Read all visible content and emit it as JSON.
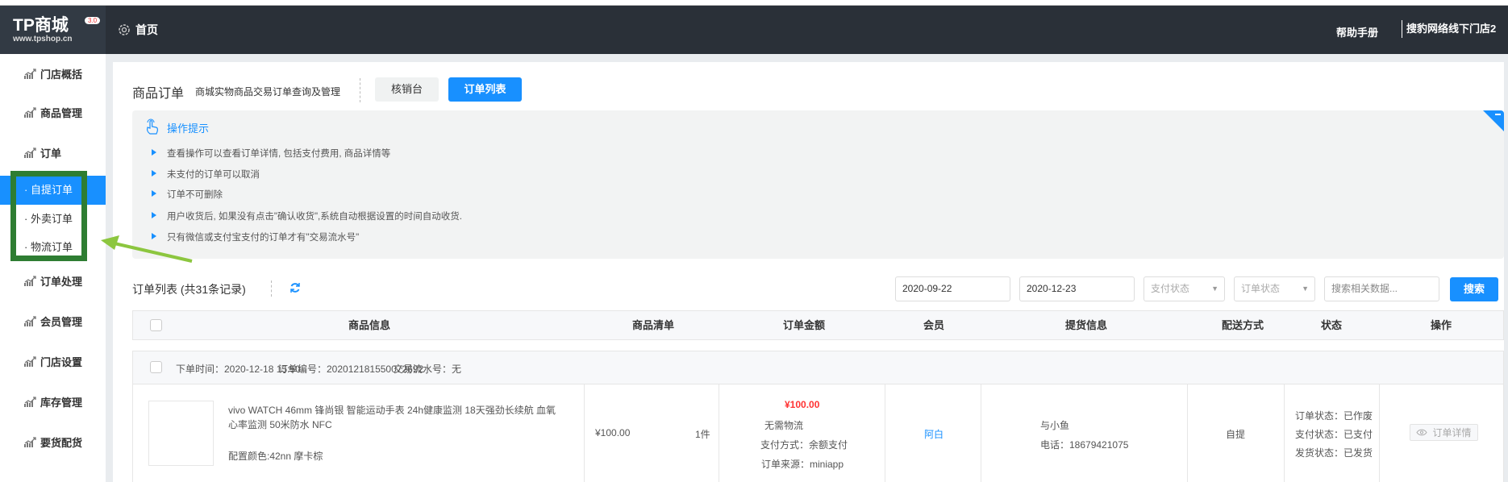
{
  "header": {
    "logo_text": "TP商城",
    "logo_version": "3.0",
    "logo_url": "www.tpshop.cn",
    "home_label": "首页",
    "help_label": "帮助手册",
    "store_name": "搜豹网络线下门店2"
  },
  "sidebar": {
    "items": [
      {
        "label": "门店概括"
      },
      {
        "label": "商品管理"
      },
      {
        "label": "订单"
      },
      {
        "label": "· 自提订单",
        "active": true
      },
      {
        "label": "· 外卖订单"
      },
      {
        "label": "· 物流订单"
      },
      {
        "label": "订单处理"
      },
      {
        "label": "会员管理"
      },
      {
        "label": "门店设置"
      },
      {
        "label": "库存管理"
      },
      {
        "label": "要货配货"
      }
    ]
  },
  "page": {
    "title": "商品订单",
    "subtitle": "商城实物商品交易订单查询及管理",
    "tabs": [
      {
        "label": "核销台"
      },
      {
        "label": "订单列表",
        "active": true
      }
    ]
  },
  "tips": {
    "title": "操作提示",
    "items": [
      "查看操作可以查看订单详情, 包括支付费用, 商品详情等",
      "未支付的订单可以取消",
      "订单不可删除",
      "用户收货后, 如果没有点击\"确认收货\",系统自动根据设置的时间自动收货.",
      "只有微信或支付宝支付的订单才有\"交易流水号\""
    ]
  },
  "list": {
    "title": "订单列表 (共31条记录)",
    "filters": {
      "start_date": "2020-09-22",
      "end_date": "2020-12-23",
      "pay_status_placeholder": "支付状态",
      "order_status_placeholder": "订单状态",
      "search_placeholder": "搜索相关数据...",
      "search_button": "搜索"
    },
    "columns": [
      "商品信息",
      "商品清单",
      "订单金额",
      "会员",
      "提货信息",
      "配送方式",
      "状态",
      "操作"
    ],
    "orders": [
      {
        "order_time": "下单时间：2020-12-18 15:50",
        "order_no": "订单编号：202012181550072692",
        "trade_no": "交易流水号：无",
        "product_title_1": "vivo WATCH 46mm 锋尚银 智能运动手表 24h健康监测 18天强劲长续航 血氧",
        "product_title_2": "心率监测 50米防水 NFC",
        "product_spec": "配置颜色:42nn 摩卡棕",
        "unit_price": "¥100.00",
        "quantity": "1件",
        "total": "¥100.00",
        "logistics": "无需物流",
        "pay_method": "支付方式：余额支付",
        "source": "订单来源：miniapp",
        "member": "阿白",
        "pickup_name": "与小鱼",
        "pickup_phone": "电话：18679421075",
        "delivery": "自提",
        "order_status": "订单状态：已作废",
        "pay_status": "支付状态：已支付",
        "ship_status": "发货状态：已发货",
        "detail_button": "订单详情"
      }
    ]
  },
  "colors": {
    "primary": "#1890ff",
    "header": "#2a3038",
    "price": "#ff3333",
    "highlight_box": "#2e7d32",
    "arrow": "#8cc63f"
  }
}
